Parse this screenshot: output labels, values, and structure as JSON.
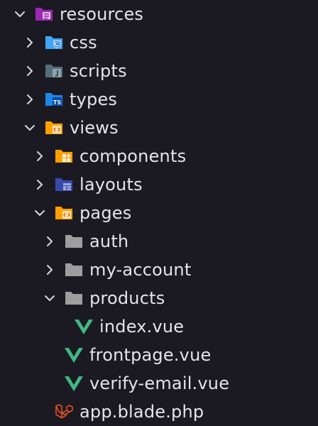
{
  "explorer": {
    "items": [
      {
        "label": "resources",
        "expanded": true,
        "icon": "folder-resources-icon"
      },
      {
        "label": "css",
        "expanded": false,
        "icon": "folder-css-icon"
      },
      {
        "label": "scripts",
        "expanded": false,
        "icon": "folder-scripts-icon"
      },
      {
        "label": "types",
        "expanded": false,
        "icon": "folder-typescript-icon"
      },
      {
        "label": "views",
        "expanded": true,
        "icon": "folder-views-icon"
      },
      {
        "label": "components",
        "expanded": false,
        "icon": "folder-components-icon"
      },
      {
        "label": "layouts",
        "expanded": false,
        "icon": "folder-layouts-icon"
      },
      {
        "label": "pages",
        "expanded": true,
        "icon": "folder-views-icon"
      },
      {
        "label": "auth",
        "expanded": false,
        "icon": "folder-icon"
      },
      {
        "label": "my-account",
        "expanded": false,
        "icon": "folder-icon"
      },
      {
        "label": "products",
        "expanded": true,
        "icon": "folder-icon"
      },
      {
        "label": "index.vue",
        "icon": "vue-icon"
      },
      {
        "label": "frontpage.vue",
        "icon": "vue-icon"
      },
      {
        "label": "verify-email.vue",
        "icon": "vue-icon"
      },
      {
        "label": "app.blade.php",
        "icon": "laravel-blade-icon"
      }
    ]
  },
  "colors": {
    "background": "#1b1a22",
    "text": "#e4e4ea",
    "chevron": "#d6d6de",
    "folder_purple": "#9c27b0",
    "folder_blue": "#42a5f5",
    "folder_gray": "#546e7a",
    "folder_ts_blue": "#1e88e5",
    "folder_orange": "#ffa000",
    "folder_indigo": "#3949ab",
    "folder_plain": "#9e9e9e",
    "vue_green": "#41b883",
    "laravel_red": "#ff5722"
  }
}
